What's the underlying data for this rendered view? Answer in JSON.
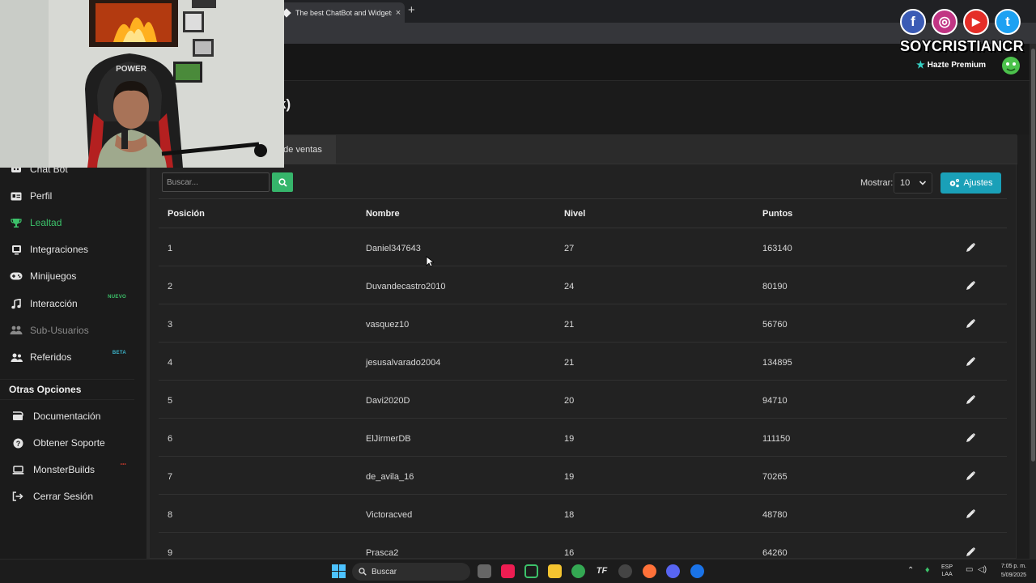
{
  "browser": {
    "tab_title": "The best ChatBot and Widgets",
    "tab_close": "×",
    "new_tab": "+"
  },
  "page": {
    "title_partial": "k)"
  },
  "tabs": {
    "active_partial": "o de ventas"
  },
  "sidebar": {
    "items": [
      {
        "label": "Chat Bot",
        "icon": "chatbot-icon",
        "state": "normal"
      },
      {
        "label": "Perfil",
        "icon": "id-card-icon",
        "state": "normal"
      },
      {
        "label": "Lealtad",
        "icon": "trophy-icon",
        "state": "active"
      },
      {
        "label": "Integraciones",
        "icon": "plug-icon",
        "state": "normal"
      },
      {
        "label": "Minijuegos",
        "icon": "gamepad-icon",
        "state": "normal"
      },
      {
        "label": "Interacción",
        "icon": "music-note-icon",
        "state": "normal",
        "badge": "NUEVO"
      },
      {
        "label": "Sub-Usuarios",
        "icon": "users-icon",
        "state": "muted"
      },
      {
        "label": "Referidos",
        "icon": "user-group-icon",
        "state": "normal",
        "badge": "BETA"
      }
    ],
    "section_title": "Otras Opciones",
    "options": [
      {
        "label": "Documentación",
        "icon": "book-icon"
      },
      {
        "label": "Obtener Soporte",
        "icon": "question-circle-icon"
      },
      {
        "label": "MonsterBuilds",
        "icon": "laptop-icon"
      },
      {
        "label": "Cerrar Sesión",
        "icon": "sign-out-icon"
      }
    ]
  },
  "toolbar": {
    "search_placeholder": "Buscar...",
    "show_label": "Mostrar:",
    "show_value": "10",
    "settings_label": "Ajustes"
  },
  "table": {
    "headers": [
      "Posición",
      "Nombre",
      "Nivel",
      "Puntos"
    ],
    "rows": [
      {
        "pos": "1",
        "name": "Daniel347643",
        "level": "27",
        "points": "163140"
      },
      {
        "pos": "2",
        "name": "Duvandecastro2010",
        "level": "24",
        "points": "80190"
      },
      {
        "pos": "3",
        "name": "vasquez10",
        "level": "21",
        "points": "56760"
      },
      {
        "pos": "4",
        "name": "jesusalvarado2004",
        "level": "21",
        "points": "134895"
      },
      {
        "pos": "5",
        "name": "Davi2020D",
        "level": "20",
        "points": "94710"
      },
      {
        "pos": "6",
        "name": "ElJirmerDB",
        "level": "19",
        "points": "111150"
      },
      {
        "pos": "7",
        "name": "de_avila_16",
        "level": "19",
        "points": "70265"
      },
      {
        "pos": "8",
        "name": "Victoracved",
        "level": "18",
        "points": "48780"
      },
      {
        "pos": "9",
        "name": "Prasca2",
        "level": "16",
        "points": "64260"
      }
    ]
  },
  "overlay": {
    "brand": "SOYCRISTIANCR",
    "premium": "Hazte Premium",
    "social": [
      {
        "name": "facebook-icon",
        "glyph": "f",
        "color": "#3b5bb5"
      },
      {
        "name": "instagram-icon",
        "glyph": "◎",
        "color": "#c13584"
      },
      {
        "name": "youtube-icon",
        "glyph": "▶",
        "color": "#e52d27"
      },
      {
        "name": "twitter-icon",
        "glyph": "t",
        "color": "#1da1f2"
      }
    ]
  },
  "taskbar": {
    "search": "Buscar",
    "lang_top": "ESP",
    "lang_bottom": "LAA",
    "time": "7:05 p. m.",
    "date": "5/09/2025"
  },
  "colors": {
    "accent_green": "#36b56b",
    "accent_cyan": "#1aa0b8",
    "active_nav": "#3cc26a"
  }
}
